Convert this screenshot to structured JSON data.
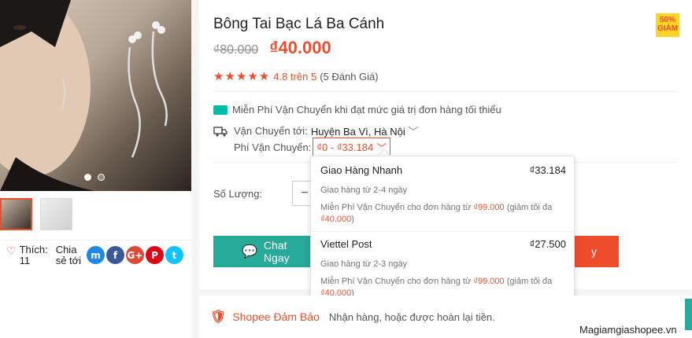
{
  "product": {
    "title": "Bông Tai Bạc Lá Ba Cánh",
    "badge": "50% GIẢM",
    "old_price": "₫80.000",
    "new_price": "₫40.000",
    "rating_stars": "★★★★★",
    "rating_value": "4.8 trên 5",
    "rating_count": "(5 Đánh Giá)"
  },
  "gallery": {
    "thumbs": [
      "thumb-1",
      "thumb-2"
    ],
    "dot_count": 2
  },
  "social": {
    "like_label": "Thích:",
    "like_count": "11",
    "share_label": "Chia sẻ tới",
    "icons": [
      {
        "name": "messenger-icon",
        "glyph": "m",
        "color": "#1e88e5"
      },
      {
        "name": "facebook-icon",
        "glyph": "f",
        "color": "#3b5999"
      },
      {
        "name": "google-plus-icon",
        "glyph": "G+",
        "color": "#db4a39"
      },
      {
        "name": "pinterest-icon",
        "glyph": "P",
        "color": "#de0217"
      },
      {
        "name": "twitter-icon",
        "glyph": "t",
        "color": "#10c2ff"
      }
    ]
  },
  "shipping": {
    "free_text": "Miễn Phí Vận Chuyển khi đạt mức giá trị đơn hàng tối thiểu",
    "to_label": "Vận Chuyển tới:",
    "location": "Huyện Ba Vì, Hà Nội",
    "fee_label": "Phí Vận Chuyển:",
    "fee_range": "₫0 - ₫33.184"
  },
  "quantity": {
    "label": "Số Lượng:",
    "minus": "−"
  },
  "actions": {
    "chat_label": "Chat Ngay",
    "buy_label": "y"
  },
  "dropdown": {
    "carriers": [
      {
        "name": "Giao Hàng Nhanh",
        "price": "₫33.184",
        "eta": "Giao hàng từ 2-4 ngày",
        "promo_prefix": "Miễn Phí Vận Chuyển cho đơn hàng từ ",
        "promo_amount": "₫99.000",
        "promo_mid": " (giảm tối đa ",
        "promo_cap": "₫40.000",
        "promo_suffix": ")"
      },
      {
        "name": "Viettel Post",
        "price": "₫27.500",
        "eta": "Giao hàng từ 2-3 ngày",
        "promo_prefix": "Miễn Phí Vận Chuyển cho đơn hàng từ ",
        "promo_amount": "₫99.000",
        "promo_mid": " (giảm tối đa ",
        "promo_cap": "₫40.000",
        "promo_suffix": ")"
      }
    ]
  },
  "guarantee": {
    "title": "Shopee Đảm Bảo",
    "text": "Nhận hàng, hoặc được hoàn lại tiền."
  },
  "watermark": "Magiamgiashopee.vn",
  "colors": {
    "accent": "#ee4d2d",
    "chat": "#26aa99"
  }
}
